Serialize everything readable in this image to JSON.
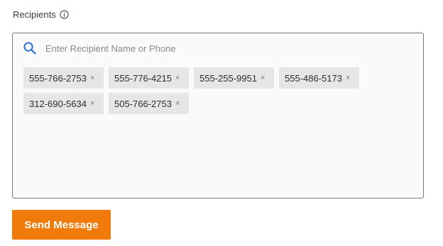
{
  "recipients": {
    "label": "Recipients",
    "info_icon": "info-circle-icon",
    "search": {
      "icon": "search-icon",
      "placeholder": "Enter Recipient Name or Phone",
      "value": ""
    },
    "chips": [
      {
        "text": "555-766-2753",
        "remove": "×"
      },
      {
        "text": "555-776-4215",
        "remove": "×"
      },
      {
        "text": "555-255-9951",
        "remove": "×"
      },
      {
        "text": "555-486-5173",
        "remove": "×"
      },
      {
        "text": "312-690-5634",
        "remove": "×"
      },
      {
        "text": "505-766-2753",
        "remove": "×"
      }
    ]
  },
  "actions": {
    "send_label": "Send Message"
  },
  "colors": {
    "accent": "#f07a0a",
    "search_icon": "#2f6fd0",
    "chip_bg": "#e6e6e6"
  }
}
